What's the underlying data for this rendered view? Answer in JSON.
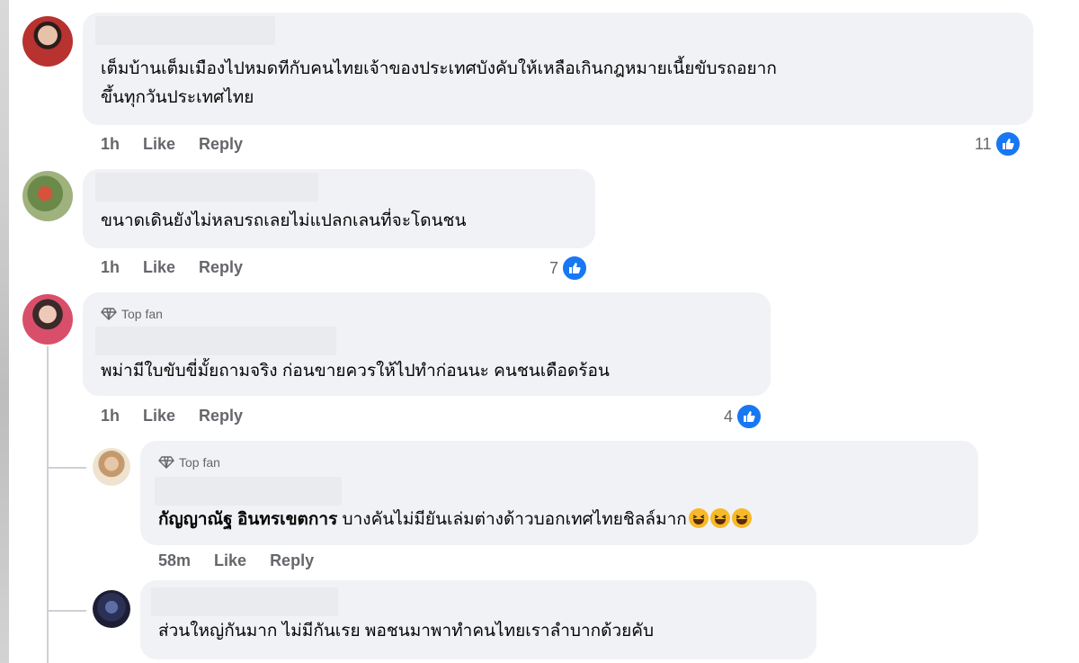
{
  "comments": [
    {
      "text_line1": "เต็มบ้านเต็มเมืองไปหมดทีกับคนไทยเจ้าของประเทศบังคับให้เหลือเกินกฎหมายเนี้ยขับรถอยาก",
      "text_line2": "ขึ้นทุกวันประเทศไทย",
      "time": "1h",
      "like": "Like",
      "reply": "Reply",
      "reactions": "11"
    },
    {
      "text": "ขนาดเดินยังไม่หลบรถเลยไม่แปลกเลนที่จะโดนชน",
      "time": "1h",
      "like": "Like",
      "reply": "Reply",
      "reactions": "7"
    },
    {
      "badge": "Top fan",
      "text": "พม่ามีใบขับขี่มั้ยถามจริง ก่อนขายควรให้ไปทำก่อนนะ คนชนเดือดร้อน",
      "time": "1h",
      "like": "Like",
      "reply": "Reply",
      "reactions": "4"
    }
  ],
  "replies": [
    {
      "badge": "Top fan",
      "author": "กัญญาณัฐ อินทรเขตการ",
      "text": " บางคันไม่มียันเล่มต่างด้าวบอกเทศไทยชิลล์มาก",
      "time": "58m",
      "like": "Like",
      "reply": "Reply"
    },
    {
      "text": "ส่วนใหญ่กันมาก ไม่มีกันเรย พอชนมาพาทำคนไทยเราลำบากด้วยคับ"
    }
  ],
  "colors": {
    "like_blue": "#1877f2",
    "bubble": "#f0f2f5",
    "meta_gray": "#65676b"
  },
  "icons": [
    "like-icon",
    "diamond-icon",
    "laughing-emoji-icon"
  ]
}
